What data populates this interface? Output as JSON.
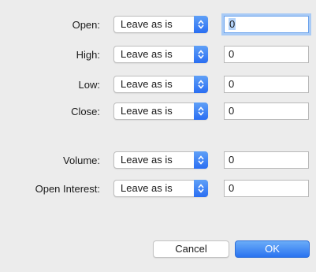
{
  "fields": [
    {
      "label": "Open:",
      "mode": "Leave as is",
      "value": "0"
    },
    {
      "label": "High:",
      "mode": "Leave as is",
      "value": "0"
    },
    {
      "label": "Low:",
      "mode": "Leave as is",
      "value": "0"
    },
    {
      "label": "Close:",
      "mode": "Leave as is",
      "value": "0"
    },
    {
      "label": "Volume:",
      "mode": "Leave as is",
      "value": "0"
    },
    {
      "label": "Open Interest:",
      "mode": "Leave as is",
      "value": "0"
    }
  ],
  "buttons": {
    "cancel": "Cancel",
    "ok": "OK"
  },
  "colors": {
    "accent": "#2a73f0",
    "focus_ring": "#a9cbf6",
    "window_bg": "#ececec"
  }
}
